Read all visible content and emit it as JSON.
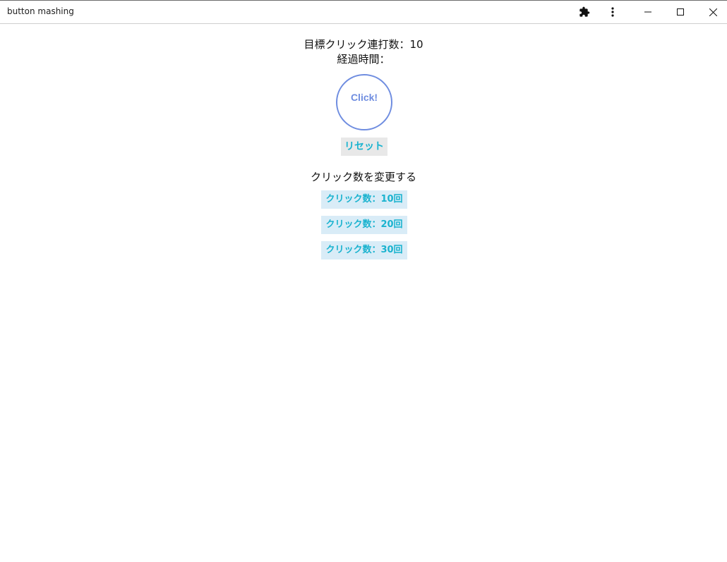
{
  "window": {
    "title": "button mashing"
  },
  "toolbar": {
    "icons": [
      "extension-icon",
      "more-vert-icon",
      "minimize-icon",
      "maximize-icon",
      "close-icon"
    ]
  },
  "game": {
    "target_label": "目標クリック連打数：",
    "target_value": "10",
    "elapsed_label": "経過時間：",
    "elapsed_value": "",
    "click_button_label": "Click!",
    "reset_button_label": "リセット"
  },
  "change_section": {
    "heading": "クリック数を変更する",
    "options": [
      {
        "label": "クリック数：10回"
      },
      {
        "label": "クリック数：20回"
      },
      {
        "label": "クリック数：30回"
      }
    ]
  },
  "colors": {
    "circle_accent": "#6f8de0",
    "button_text": "#1ab3cf",
    "reset_bg": "#e8e8e8",
    "option_bg": "#d9ecf7"
  }
}
